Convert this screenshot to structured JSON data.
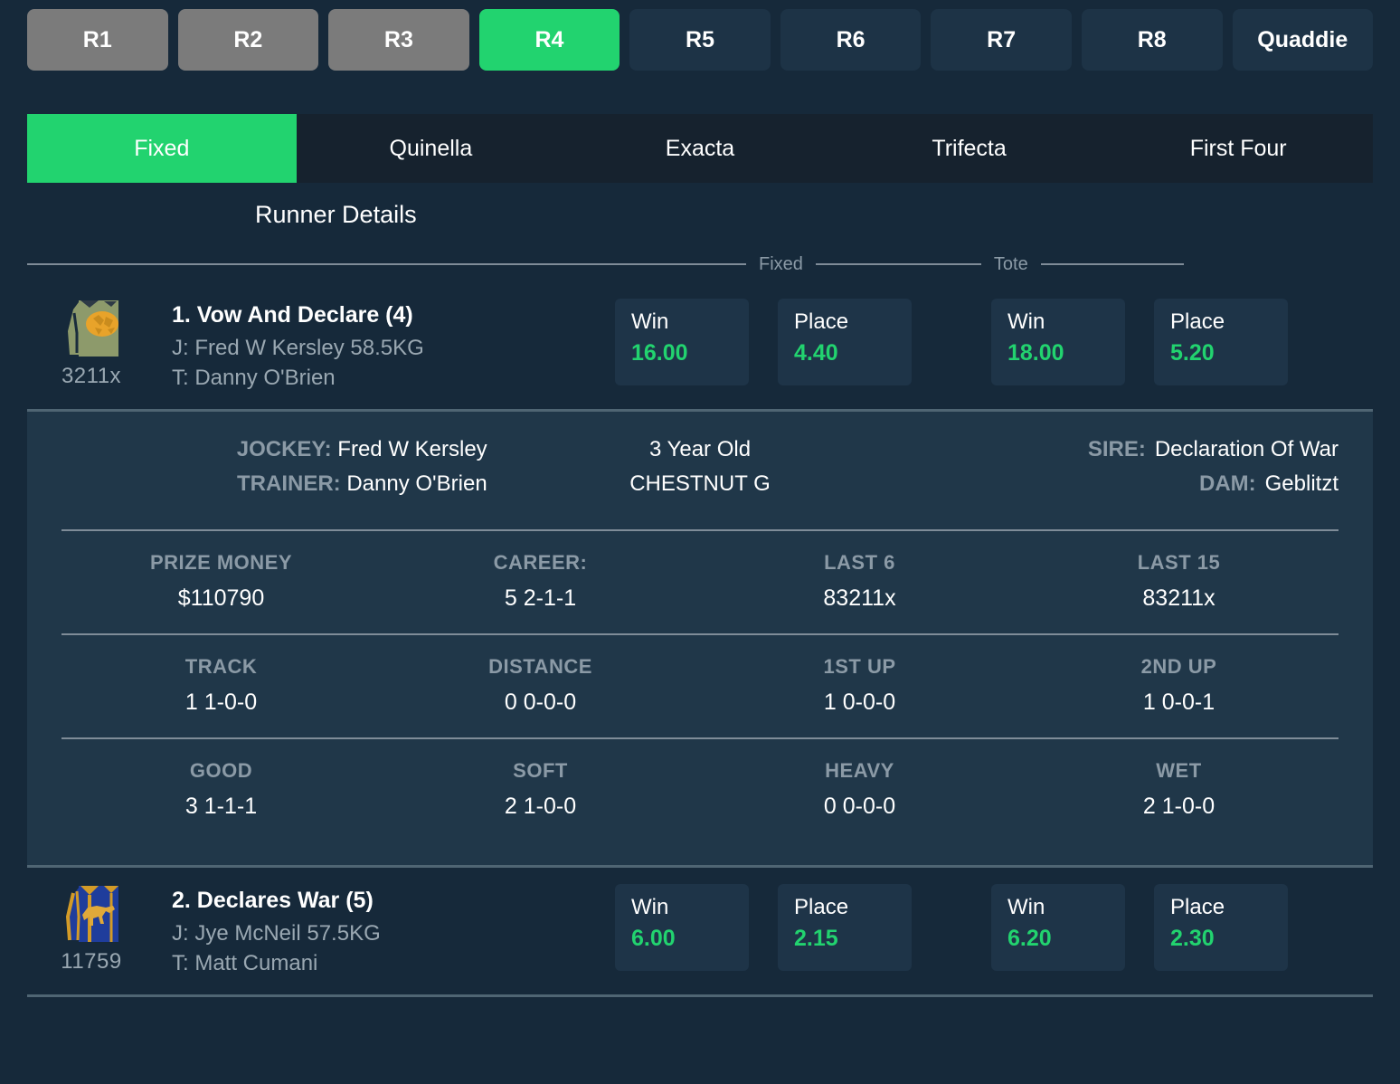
{
  "race_tabs": [
    {
      "label": "R1",
      "state": "past"
    },
    {
      "label": "R2",
      "state": "past"
    },
    {
      "label": "R3",
      "state": "past"
    },
    {
      "label": "R4",
      "state": "active"
    },
    {
      "label": "R5",
      "state": "upcoming"
    },
    {
      "label": "R6",
      "state": "upcoming"
    },
    {
      "label": "R7",
      "state": "upcoming"
    },
    {
      "label": "R8",
      "state": "upcoming"
    },
    {
      "label": "Quaddie",
      "state": "upcoming"
    }
  ],
  "bet_types": [
    {
      "label": "Fixed",
      "active": true
    },
    {
      "label": "Quinella",
      "active": false
    },
    {
      "label": "Exacta",
      "active": false
    },
    {
      "label": "Trifecta",
      "active": false
    },
    {
      "label": "First Four",
      "active": false
    }
  ],
  "runner_details_heading": "Runner Details",
  "market_headers": {
    "fixed": "Fixed",
    "tote": "Tote"
  },
  "colors": {
    "accent_green": "#22d36f",
    "page_bg": "#16293a",
    "panel_bg": "#203749",
    "odds_bg": "#1e3448",
    "muted_text": "#8b9aa6"
  },
  "runners": [
    {
      "silk": "silk-olive-orange",
      "form": "3211x",
      "name": "1. Vow And Declare (4)",
      "jockey_line": "J: Fred W Kersley 58.5KG",
      "trainer_line": "T: Danny O'Brien",
      "odds": [
        {
          "label": "Win",
          "value": "16.00"
        },
        {
          "label": "Place",
          "value": "4.40"
        },
        {
          "label": "Win",
          "value": "18.00"
        },
        {
          "label": "Place",
          "value": "5.20"
        }
      ],
      "expanded": true,
      "detail": {
        "jockey_key": "JOCKEY:",
        "jockey_value": "Fred W Kersley",
        "trainer_key": "TRAINER:",
        "trainer_value": "Danny O'Brien",
        "age": "3 Year Old",
        "colour_sex": "CHESTNUT G",
        "sire_key": "SIRE:",
        "sire_value": "Declaration Of War",
        "dam_key": "DAM:",
        "dam_value": "Geblitzt",
        "stat_rows": [
          [
            {
              "label": "PRIZE MONEY",
              "value": "$110790"
            },
            {
              "label": "CAREER:",
              "value": "5 2-1-1"
            },
            {
              "label": "LAST 6",
              "value": "83211x"
            },
            {
              "label": "LAST 15",
              "value": "83211x"
            }
          ],
          [
            {
              "label": "TRACK",
              "value": "1 1-0-0"
            },
            {
              "label": "DISTANCE",
              "value": "0 0-0-0"
            },
            {
              "label": "1ST UP",
              "value": "1 0-0-0"
            },
            {
              "label": "2ND UP",
              "value": "1 0-0-1"
            }
          ],
          [
            {
              "label": "GOOD",
              "value": "3 1-1-1"
            },
            {
              "label": "SOFT",
              "value": "2 1-0-0"
            },
            {
              "label": "HEAVY",
              "value": "0 0-0-0"
            },
            {
              "label": "WET",
              "value": "2 1-0-0"
            }
          ]
        ]
      }
    },
    {
      "silk": "silk-blue-gold",
      "form": "11759",
      "name": "2. Declares War (5)",
      "jockey_line": "J: Jye McNeil 57.5KG",
      "trainer_line": "T: Matt Cumani",
      "odds": [
        {
          "label": "Win",
          "value": "6.00"
        },
        {
          "label": "Place",
          "value": "2.15"
        },
        {
          "label": "Win",
          "value": "6.20"
        },
        {
          "label": "Place",
          "value": "2.30"
        }
      ],
      "expanded": false
    }
  ]
}
